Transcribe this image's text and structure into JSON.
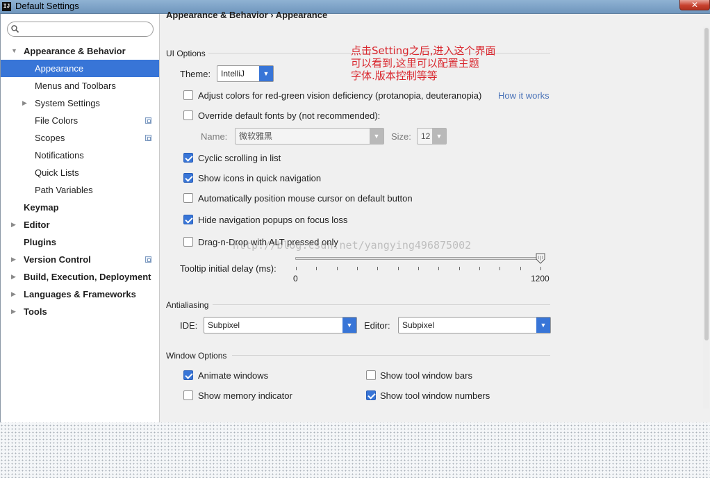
{
  "window": {
    "title": "Default Settings",
    "icon_text": "IJ",
    "close_label": "✕"
  },
  "search": {
    "value": "",
    "placeholder": ""
  },
  "tree": {
    "appearance_behavior": "Appearance & Behavior",
    "appearance": "Appearance",
    "menus_toolbars": "Menus and Toolbars",
    "system_settings": "System Settings",
    "file_colors": "File Colors",
    "scopes": "Scopes",
    "notifications": "Notifications",
    "quick_lists": "Quick Lists",
    "path_variables": "Path Variables",
    "keymap": "Keymap",
    "editor": "Editor",
    "plugins": "Plugins",
    "version_control": "Version Control",
    "build": "Build, Execution, Deployment",
    "languages": "Languages & Frameworks",
    "tools": "Tools"
  },
  "breadcrumb": {
    "parent": "Appearance & Behavior",
    "separator": "›",
    "current": "Appearance"
  },
  "ui_options": {
    "section": "UI Options",
    "theme_label": "Theme:",
    "theme_value": "IntelliJ",
    "adjust_colors": "Adjust colors for red-green vision deficiency (protanopia, deuteranopia)",
    "how_it_works": "How it works",
    "override_fonts": "Override default fonts by (not recommended):",
    "name_label": "Name:",
    "name_value": "微软雅黑",
    "size_label": "Size:",
    "size_value": "12",
    "cyclic_scrolling": "Cyclic scrolling in list",
    "show_icons": "Show icons in quick navigation",
    "auto_position": "Automatically position mouse cursor on default button",
    "hide_popups": "Hide navigation popups on focus loss",
    "drag_drop": "Drag-n-Drop with ALT pressed only",
    "tooltip_label": "Tooltip initial delay (ms):",
    "slider_min": "0",
    "slider_max": "1200",
    "tooltip_value": 1200
  },
  "antialiasing": {
    "section": "Antialiasing",
    "ide_label": "IDE:",
    "ide_value": "Subpixel",
    "editor_label": "Editor:",
    "editor_value": "Subpixel"
  },
  "window_options": {
    "section": "Window Options",
    "animate_windows": "Animate windows",
    "show_memory": "Show memory indicator",
    "show_tool_bars": "Show tool window bars",
    "show_tool_numbers": "Show tool window numbers"
  },
  "annotation": {
    "line1": "点击Setting之后,进入这个界面",
    "line2": "可以看到,这里可以配置主题",
    "line3": "字体.版本控制等等"
  },
  "watermark": "http://blog.csdn.net/yangying496875002",
  "colors": {
    "selection": "#3875d7",
    "annotation": "#d9272e",
    "link": "#4a73b8"
  }
}
